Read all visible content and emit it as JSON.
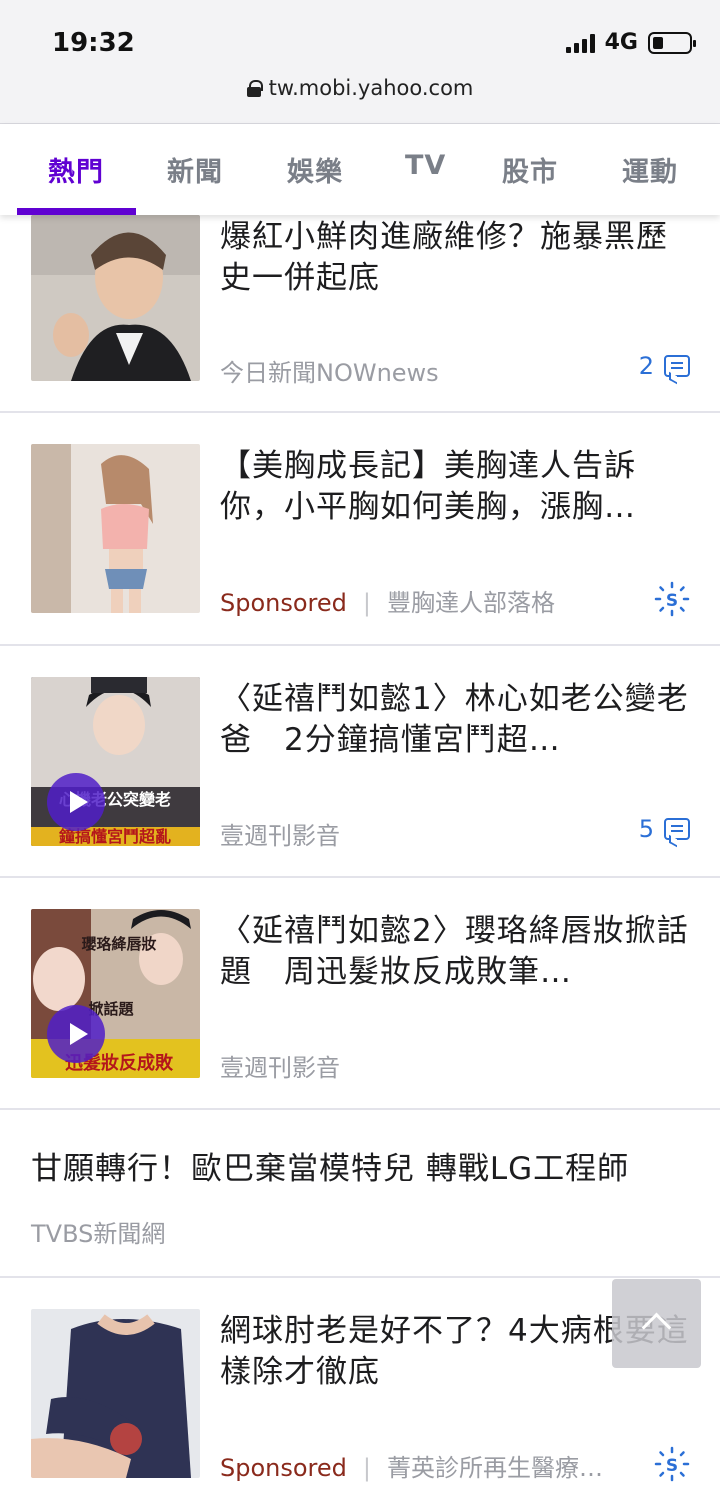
{
  "status_bar": {
    "time": "19:32",
    "network": "4G"
  },
  "browser": {
    "url": "tw.mobi.yahoo.com"
  },
  "tabs": [
    {
      "label": "熱門",
      "active": true
    },
    {
      "label": "新聞"
    },
    {
      "label": "娛樂"
    },
    {
      "label": "TV"
    },
    {
      "label": "股市"
    },
    {
      "label": "運動"
    }
  ],
  "feed": [
    {
      "title": "爆紅小鮮肉進廠維修？施暴黑歷史一併起底",
      "source": "今日新聞NOWnews",
      "comments": "2"
    },
    {
      "title": "【美胸成長記】美胸達人告訴你，小平胸如何美胸，漲胸…",
      "sponsored": "Sponsored",
      "source": "豐胸達人部落格"
    },
    {
      "title": "〈延禧鬥如懿1〉林心如老公變老爸　2分鐘搞懂宮鬥超…",
      "source": "壹週刊影音",
      "comments": "5"
    },
    {
      "title": "〈延禧鬥如懿2〉瓔珞絳唇妝掀話題　周迅髮妝反成敗筆…",
      "source": "壹週刊影音"
    },
    {
      "title": "甘願轉行！歐巴棄當模特兒 轉戰LG工程師",
      "source": "TVBS新聞網"
    },
    {
      "title": "網球肘老是好不了？4大病根要這樣除才徹底",
      "sponsored": "Sponsored",
      "source": "菁英診所再生醫療…"
    }
  ],
  "thumb_texts": {
    "item3_overlay1": "心機老公突變老",
    "item3_overlay2": "鐘搞懂宮鬥超亂",
    "item4_overlay1": "瓔珞絳唇妝",
    "item4_overlay2": "掀話題",
    "item4_overlay3": "迅髮妝反成敗"
  },
  "colors": {
    "accent": "#6001d2",
    "comment_blue": "#2b6fd6",
    "sponsored": "#8a2a1c"
  }
}
